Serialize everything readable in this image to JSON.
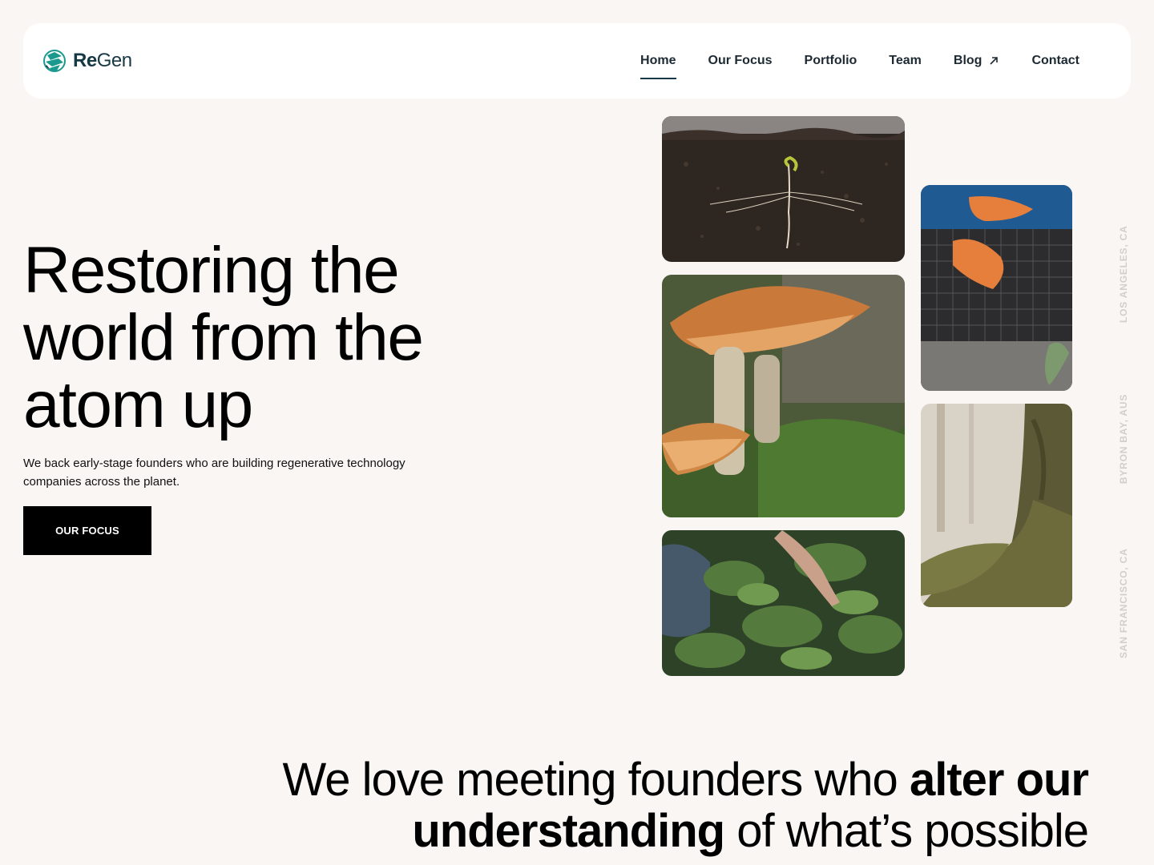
{
  "brand": {
    "name_bold": "Re",
    "name_regular": "Gen",
    "accent_color": "#1a9a8e",
    "text_color": "#173845",
    "icon": "regen-logo-icon"
  },
  "nav": {
    "items": [
      {
        "label": "Home",
        "active": true
      },
      {
        "label": "Our Focus",
        "active": false
      },
      {
        "label": "Portfolio",
        "active": false
      },
      {
        "label": "Team",
        "active": false
      },
      {
        "label": "Blog",
        "active": false,
        "icon": "external-arrow-icon"
      },
      {
        "label": "Contact",
        "active": false
      }
    ]
  },
  "hero": {
    "title_line1": "Restoring the",
    "title_line2": "world from the",
    "title_line3": "atom up",
    "subtitle_line1": "We back early-stage founders who are building regenerative technology",
    "subtitle_line2": "companies across the planet.",
    "cta_label": "OUR FOCUS"
  },
  "gallery": {
    "images": [
      "seedling-in-soil",
      "mushrooms-on-moss",
      "hand-picking-spinach",
      "gloved-hands-seed-tray",
      "mossy-tree-roots"
    ]
  },
  "locations": [
    "LOS ANGELES, CA",
    "BYRON BAY, AUS",
    "SAN FRANCISCO, CA"
  ],
  "tagline": {
    "part1": "We love meeting founders who ",
    "bold1": "alter our",
    "bold2": "understanding",
    "part2": " of what’s possible"
  }
}
